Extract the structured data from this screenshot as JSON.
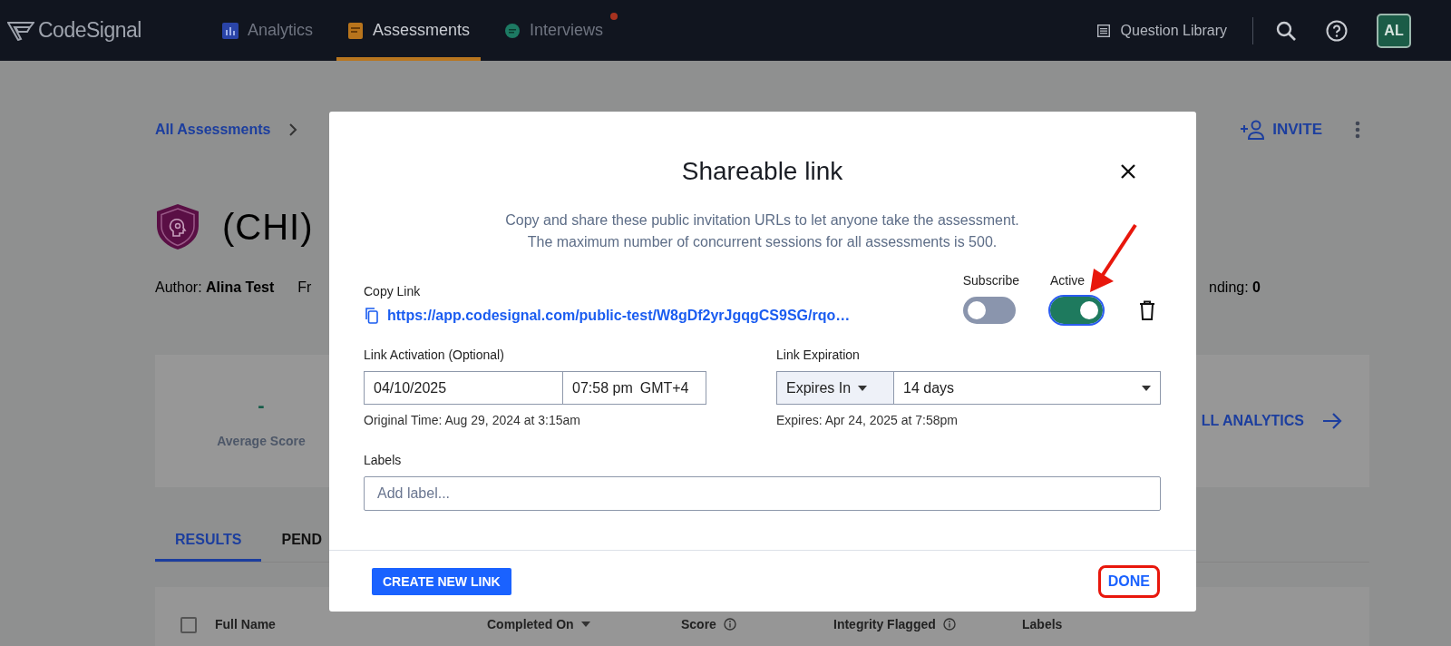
{
  "nav": {
    "logo": "CodeSignal",
    "tabs": [
      {
        "label": "Analytics",
        "selected": false,
        "badge": false,
        "kind": "analytics"
      },
      {
        "label": "Assessments",
        "selected": true,
        "badge": false,
        "kind": "assessments"
      },
      {
        "label": "Interviews",
        "selected": false,
        "badge": true,
        "kind": "interviews"
      }
    ],
    "question_library": "Question Library",
    "avatar": "AL"
  },
  "page": {
    "breadcrumb": "All Assessments",
    "invite": "INVITE",
    "title": "(CHI)",
    "author": "Author: **Alina Test**",
    "meta_2": "Fr",
    "meta_3": "nding: **0**",
    "stat_value": "-",
    "stat_label": "Average Score",
    "analytics_link": "LL ANALYTICS",
    "tabs": [
      {
        "label": "RESULTS",
        "selected": true
      },
      {
        "label": "PEND",
        "selected": false
      }
    ],
    "table": {
      "select_all_checked": false,
      "columns": [
        {
          "label": "Full Name",
          "kind": "plain"
        },
        {
          "label": "Completed On",
          "kind": "sort"
        },
        {
          "label": "Score",
          "kind": "info"
        },
        {
          "label": "Integrity Flagged",
          "kind": "info"
        },
        {
          "label": "Labels",
          "kind": "plain"
        }
      ]
    }
  },
  "modal": {
    "title": "Shareable link",
    "description": [
      "Copy and share these public invitation URLs to let anyone take the assessment.",
      "The maximum number of concurrent sessions for all assessments is 500."
    ],
    "copy_link_label": "Copy Link",
    "link": "https://app.codesignal.com/public-test/W8gDf2yrJgqgCS9SG/rqo…",
    "toggles": [
      {
        "label": "Subscribe",
        "on": false,
        "focused": false
      },
      {
        "label": "Active",
        "on": true,
        "focused": true
      }
    ],
    "activation": {
      "label": "Link Activation (Optional)",
      "date": "04/10/2025",
      "time": "07:58 pm",
      "timezone": "GMT+4",
      "note": "Original Time: Aug 29, 2024 at 3:15am"
    },
    "expiration": {
      "label": "Link Expiration",
      "mode": "Expires In",
      "duration": "14 days",
      "note": "Expires: Apr 24, 2025 at 7:58pm"
    },
    "labels": {
      "label": "Labels",
      "placeholder": "Add label..."
    },
    "buttons": {
      "create": "CREATE NEW LINK",
      "done": "DONE"
    }
  }
}
